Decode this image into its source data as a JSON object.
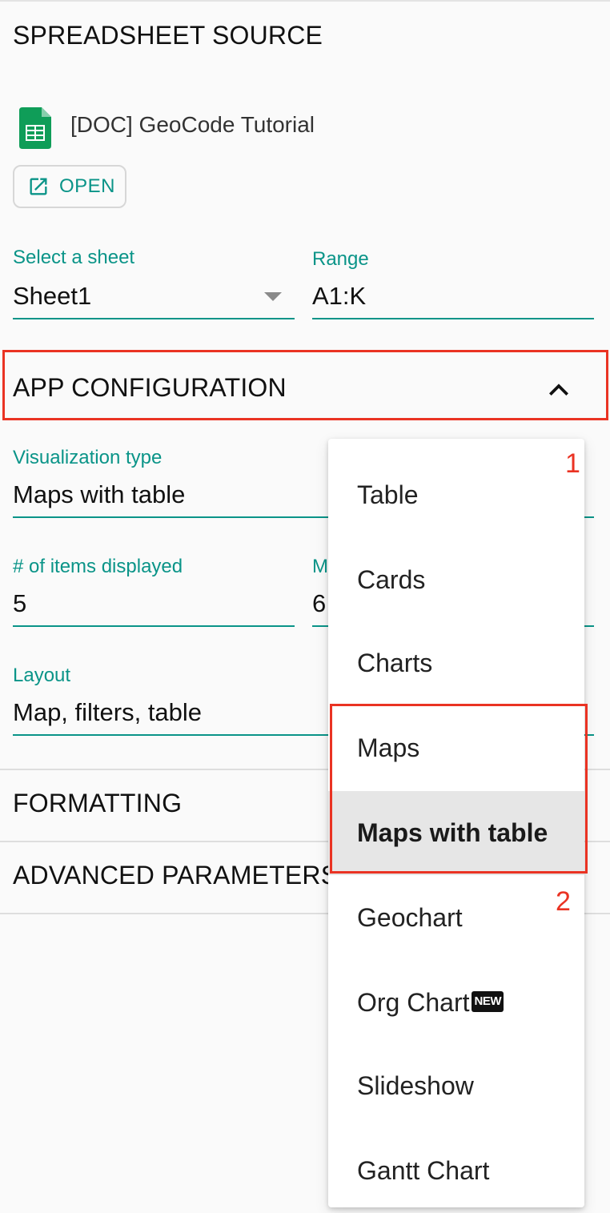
{
  "spreadsheet_source": {
    "title": "SPREADSHEET SOURCE",
    "doc_name": "[DOC] GeoCode Tutorial",
    "open_label": "OPEN",
    "sheet_label": "Select a sheet",
    "sheet_value": "Sheet1",
    "range_label": "Range",
    "range_value": "A1:K"
  },
  "app_configuration": {
    "title": "APP CONFIGURATION",
    "visualization_label": "Visualization type",
    "visualization_value": "Maps with table",
    "items_label": "# of items displayed",
    "items_value": "5",
    "second_label_partial": "M",
    "second_value_partial": "6",
    "layout_label": "Layout",
    "layout_value": "Map, filters, table"
  },
  "formatting": {
    "title": "FORMATTING"
  },
  "advanced": {
    "title": "ADVANCED PARAMETERS"
  },
  "dropdown": {
    "options": [
      {
        "label": "Table"
      },
      {
        "label": "Cards"
      },
      {
        "label": "Charts"
      },
      {
        "label": "Maps"
      },
      {
        "label": "Maps with table"
      },
      {
        "label": "Geochart"
      },
      {
        "label": "Org Chart",
        "badge": "NEW"
      },
      {
        "label": "Slideshow"
      },
      {
        "label": "Gantt Chart"
      }
    ],
    "selected": "Maps with table"
  },
  "annotations": {
    "step1": "1",
    "step2": "2"
  },
  "colors": {
    "accent": "#0a9488",
    "highlight": "#ea3323",
    "background": "#fafafa",
    "selected_item_bg": "#e6e6e6"
  },
  "icons": {
    "doc": "google-sheets-icon",
    "open": "open-in-new-icon",
    "collapse": "chevron-up-icon",
    "dropdown": "dropdown-arrow-icon"
  }
}
